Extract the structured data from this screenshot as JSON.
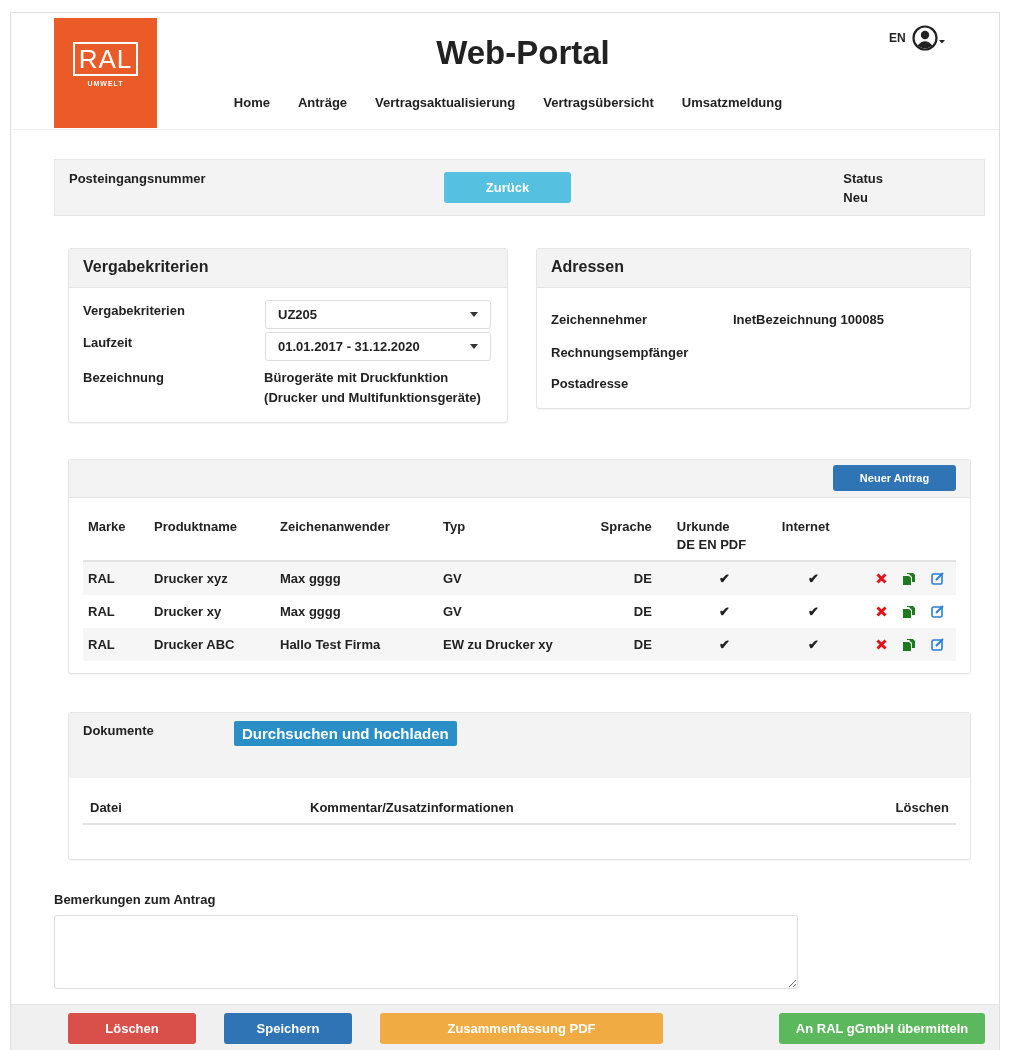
{
  "header": {
    "logo": {
      "mark": "RAL",
      "subtitle": "UMWELT"
    },
    "title": "Web-Portal",
    "language": "EN",
    "nav": [
      "Home",
      "Anträge",
      "Vertragsaktualisierung",
      "Vertragsübersicht",
      "Umsatzmeldung"
    ]
  },
  "info_bar": {
    "label": "Posteingangsnummer",
    "back_button": "Zurück",
    "status_label": "Status",
    "status_value": "Neu"
  },
  "criteria": {
    "title": "Vergabekriterien",
    "rows": [
      {
        "kind": "select",
        "label": "Vergabekriterien",
        "value": "UZ205"
      },
      {
        "kind": "select",
        "label": "Laufzeit",
        "value": "01.01.2017 - 31.12.2020"
      },
      {
        "kind": "text",
        "label": "Bezeichnung",
        "value": "Bürogeräte mit Druckfunktion (Drucker und Multifunktionsgeräte)"
      }
    ]
  },
  "addresses": {
    "title": "Adressen",
    "rows": [
      {
        "label": "Zeichennehmer",
        "value": "InetBezeichnung 100085"
      },
      {
        "label": "Rechnungsempfänger"
      },
      {
        "label": "Postadresse"
      }
    ]
  },
  "products": {
    "new_button": "Neuer Antrag",
    "columns": [
      "Marke",
      "Produktname",
      "Zeichenanwender",
      "Typ",
      "Sprache",
      "Urkunde DE EN PDF",
      "Internet"
    ],
    "rows": [
      {
        "cells": [
          "RAL",
          "Drucker xyz",
          "Max gggg",
          "GV",
          "DE",
          "✔",
          "✔"
        ]
      },
      {
        "cells": [
          "RAL",
          "Drucker xy",
          "Max gggg",
          "GV",
          "DE",
          "✔",
          "✔"
        ]
      },
      {
        "cells": [
          "RAL",
          "Drucker ABC",
          "Hallo Test Firma",
          "EW zu Drucker xy",
          "DE",
          "✔",
          "✔"
        ]
      }
    ]
  },
  "documents": {
    "label": "Dokumente",
    "upload_button": "Durchsuchen und hochladen",
    "columns": [
      "Datei",
      "Kommentar/Zusatzinformationen",
      "Löschen"
    ]
  },
  "remarks": {
    "label": "Bemerkungen zum Antrag"
  },
  "footer_buttons": [
    {
      "kind": "danger",
      "label": "Löschen"
    },
    {
      "kind": "primary",
      "label": "Speichern"
    },
    {
      "kind": "warning",
      "label": "Zusammenfassung PDF"
    },
    {
      "kind": "success",
      "label": "An RAL gGmbH übermitteln"
    }
  ]
}
